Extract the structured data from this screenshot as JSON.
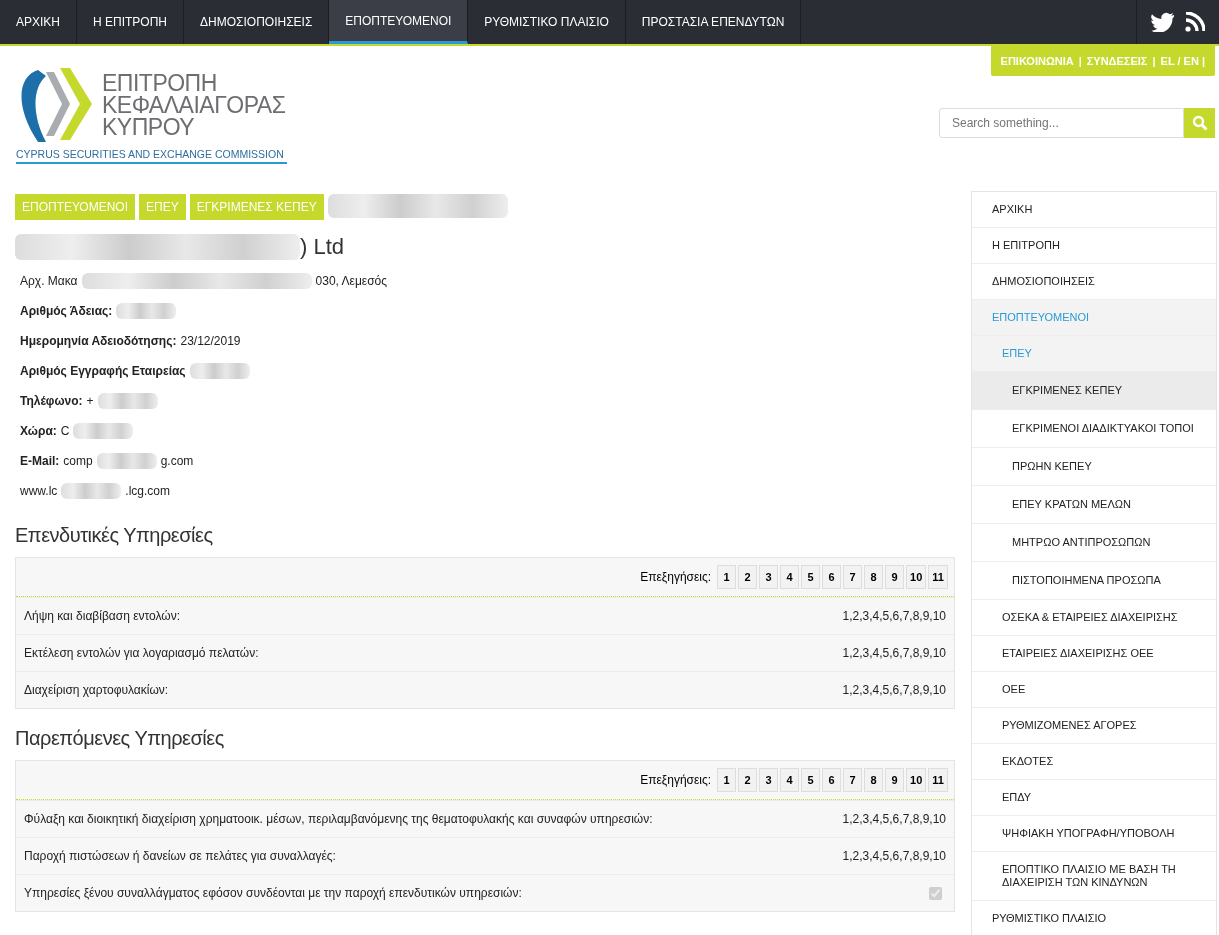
{
  "top_nav": [
    {
      "label": "ΑΡΧΙΚΗ",
      "selected": false
    },
    {
      "label": "Η ΕΠΙΤΡΟΠΗ",
      "selected": false
    },
    {
      "label": "ΔΗΜΟΣΙΟΠΟΙΗΣΕΙΣ",
      "selected": false
    },
    {
      "label": "ΕΠΟΠΤΕΥΟΜΕΝΟΙ",
      "selected": true
    },
    {
      "label": "ΡΥΘΜΙΣΤΙΚΟ ΠΛΑΙΣΙΟ",
      "selected": false
    },
    {
      "label": "ΠΡΟΣΤΑΣΙΑ ΕΠΕΝΔΥΤΩΝ",
      "selected": false
    }
  ],
  "utility_links": [
    "ΕΠΙΚΟΙΝΩΝΙΑ",
    "|",
    "ΣΥΝΔΕΣΕΙΣ",
    "|",
    "EL / EN |"
  ],
  "logo": {
    "lines": [
      "ΕΠΙΤΡΟΠΗ",
      "ΚΕΦΑΛΑΙΑΓΟΡΑΣ",
      "ΚΥΠΡΟΥ"
    ],
    "subtitle": "CYPRUS SECURITIES AND EXCHANGE COMMISSION"
  },
  "search": {
    "placeholder": "Search something..."
  },
  "breadcrumb": [
    {
      "label": "ΕΠΟΠΤΕΥΟΜΕΝΟΙ",
      "redacted": false
    },
    {
      "label": "ΕΠΕΥ",
      "redacted": false
    },
    {
      "label": "ΕΓΚΡΙΜΕΝΕΣ ΚΕΠΕΥ",
      "redacted": false
    },
    {
      "redacted": true
    }
  ],
  "company": {
    "title_end": ") Ltd",
    "redacted": true
  },
  "details": [
    {
      "value_start": "Αρχ. Μακα",
      "value_end": "030, Λεμεσός",
      "redacted": true
    },
    {
      "label": "Αριθμός Άδειας:",
      "redacted": true
    },
    {
      "label": "Ημερομηνία Αδειοδότησης:",
      "value_start": "23/12/2019",
      "redacted": false
    },
    {
      "label": "Αριθμός Εγγραφής Εταιρείας",
      "redacted": true
    },
    {
      "label": "Τηλέφωνο:",
      "value_start": "+",
      "redacted": true
    },
    {
      "label": "Χώρα:",
      "value_start": "C",
      "redacted": true
    },
    {
      "label": "E-Mail:",
      "value_start": "comp",
      "value_end": "g.com",
      "redacted": true
    },
    {
      "value_start": "www.lc",
      "value_end": ".lcg.com",
      "redacted": true
    }
  ],
  "sections": [
    {
      "title": "Επενδυτικές Υπηρεσίες",
      "legend_label": "Επεξηγήσεις:",
      "legend": [
        "1",
        "2",
        "3",
        "4",
        "5",
        "6",
        "7",
        "8",
        "9",
        "10",
        "11"
      ],
      "rows": [
        {
          "kind": "codes",
          "service": "Λήψη και διαβίβαση εντολών:",
          "codes": "1,2,3,4,5,6,7,8,9,10"
        },
        {
          "kind": "codes",
          "service": "Εκτέλεση εντολών για λογαριασμό πελατών:",
          "codes": "1,2,3,4,5,6,7,8,9,10"
        },
        {
          "kind": "codes",
          "service": "Διαχείριση χαρτοφυλακίων:",
          "codes": "1,2,3,4,5,6,7,8,9,10"
        }
      ]
    },
    {
      "title": "Παρεπόμενες Υπηρεσίες",
      "legend_label": "Επεξηγήσεις:",
      "legend": [
        "1",
        "2",
        "3",
        "4",
        "5",
        "6",
        "7",
        "8",
        "9",
        "10",
        "11"
      ],
      "rows": [
        {
          "kind": "codes",
          "service": "Φύλαξη και διοικητική διαχείριση χρηματοοικ. μέσων, περιλαμβανόμενης της θεματοφυλακής και συναφών υπηρεσιών:",
          "codes": "1,2,3,4,5,6,7,8,9,10"
        },
        {
          "kind": "codes",
          "service": "Παροχή πιστώσεων ή δανείων σε πελάτες για συναλλαγές:",
          "codes": "1,2,3,4,5,6,7,8,9,10"
        },
        {
          "kind": "checkbox",
          "service": "Υπηρεσίες ξένου συναλλάγματος εφόσον συνδέονται με την παροχή επενδυτικών υπηρεσιών:",
          "checked": true,
          "disabled": true
        }
      ]
    }
  ],
  "sidebar": {
    "items": [
      {
        "label": "ΑΡΧΙΚΗ",
        "selected": false
      },
      {
        "label": "Η ΕΠΙΤΡΟΠΗ",
        "selected": false
      },
      {
        "label": "ΔΗΜΟΣΙΟΠΟΙΗΣΕΙΣ",
        "selected": false
      },
      {
        "label": "ΕΠΟΠΤΕΥΟΜΕΝΟΙ",
        "selected": true,
        "children": [
          {
            "label": "ΕΠΕΥ",
            "selected": true,
            "children": [
              {
                "label": "ΕΓΚΡΙΜΕΝΕΣ ΚΕΠΕΥ",
                "selected": true
              },
              {
                "label": "ΕΓΚΡΙΜΕΝΟΙ ΔΙΑΔΙΚΤΥΑΚΟΙ ΤΟΠΟΙ",
                "selected": false
              },
              {
                "label": "ΠΡΩΗΝ ΚΕΠΕΥ",
                "selected": false
              },
              {
                "label": "ΕΠΕΥ ΚΡΑΤΩΝ ΜΕΛΩΝ",
                "selected": false
              },
              {
                "label": "ΜΗΤΡΩΟ ΑΝΤΙΠΡΟΣΩΠΩΝ",
                "selected": false
              },
              {
                "label": "ΠΙΣΤΟΠΟΙΗΜΕΝΑ ΠΡΟΣΩΠΑ",
                "selected": false
              }
            ]
          },
          {
            "label": "ΟΣΕΚΑ & ΕΤΑΙΡΕΙΕΣ ΔΙΑΧΕΙΡΙΣΗΣ",
            "selected": false
          },
          {
            "label": "ΕΤΑΙΡΕΙΕΣ ΔΙΑΧΕΙΡΙΣΗΣ ΟΕΕ",
            "selected": false
          },
          {
            "label": "ΟΕΕ",
            "selected": false
          },
          {
            "label": "ΡΥΘΜΙΖΟΜΕΝΕΣ ΑΓΟΡΕΣ",
            "selected": false
          },
          {
            "label": "ΕΚΔΟΤΕΣ",
            "selected": false
          },
          {
            "label": "ΕΠΔΥ",
            "selected": false
          },
          {
            "label": "ΨΗΦΙΑΚΗ ΥΠΟΓΡΑΦΗ/ΥΠΟΒΟΛΗ",
            "selected": false
          },
          {
            "label": "ΕΠΟΠΤΙΚΟ ΠΛΑΙΣΙΟ ΜΕ ΒΑΣΗ ΤΗ ΔΙΑΧΕΙΡΙΣΗ ΤΩΝ ΚΙΝΔΥΝΩΝ",
            "selected": false
          }
        ]
      },
      {
        "label": "ΡΥΘΜΙΣΤΙΚΟ ΠΛΑΙΣΙΟ",
        "selected": false
      }
    ]
  }
}
